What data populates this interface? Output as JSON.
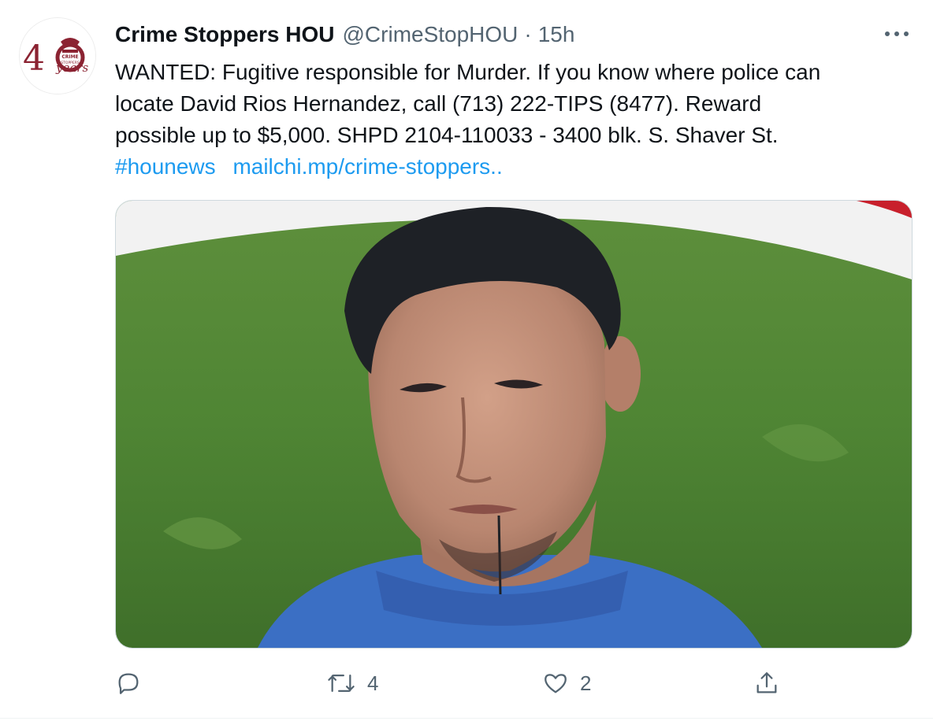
{
  "tweet": {
    "author": {
      "name": "Crime Stoppers HOU",
      "handle": "@CrimeStopHOU",
      "separator": "·",
      "time": "15h",
      "avatar": {
        "big_number": "4",
        "small_top": "CRIME",
        "small_bottom": "STOPPERS",
        "script": "years"
      }
    },
    "text": {
      "line1": "WANTED: Fugitive responsible for Murder. If you know where police can",
      "line2": "locate David Rios Hernandez, call (713) 222-TIPS (8477). Reward",
      "line3": "possible up to $5,000. SHPD 2104-110033 - 3400 blk. S. Shaver St.",
      "hashtag": "#hounews",
      "url": "mailchi.mp/crime-stoppers.."
    },
    "actions": {
      "reply_count": "",
      "retweet_count": "4",
      "like_count": "2"
    },
    "colors": {
      "link": "#1d9bf0",
      "secondary_text": "#536471",
      "brand_maroon": "#8b2332"
    },
    "icons": [
      "more-icon",
      "reply-icon",
      "retweet-icon",
      "like-icon",
      "share-icon"
    ]
  }
}
